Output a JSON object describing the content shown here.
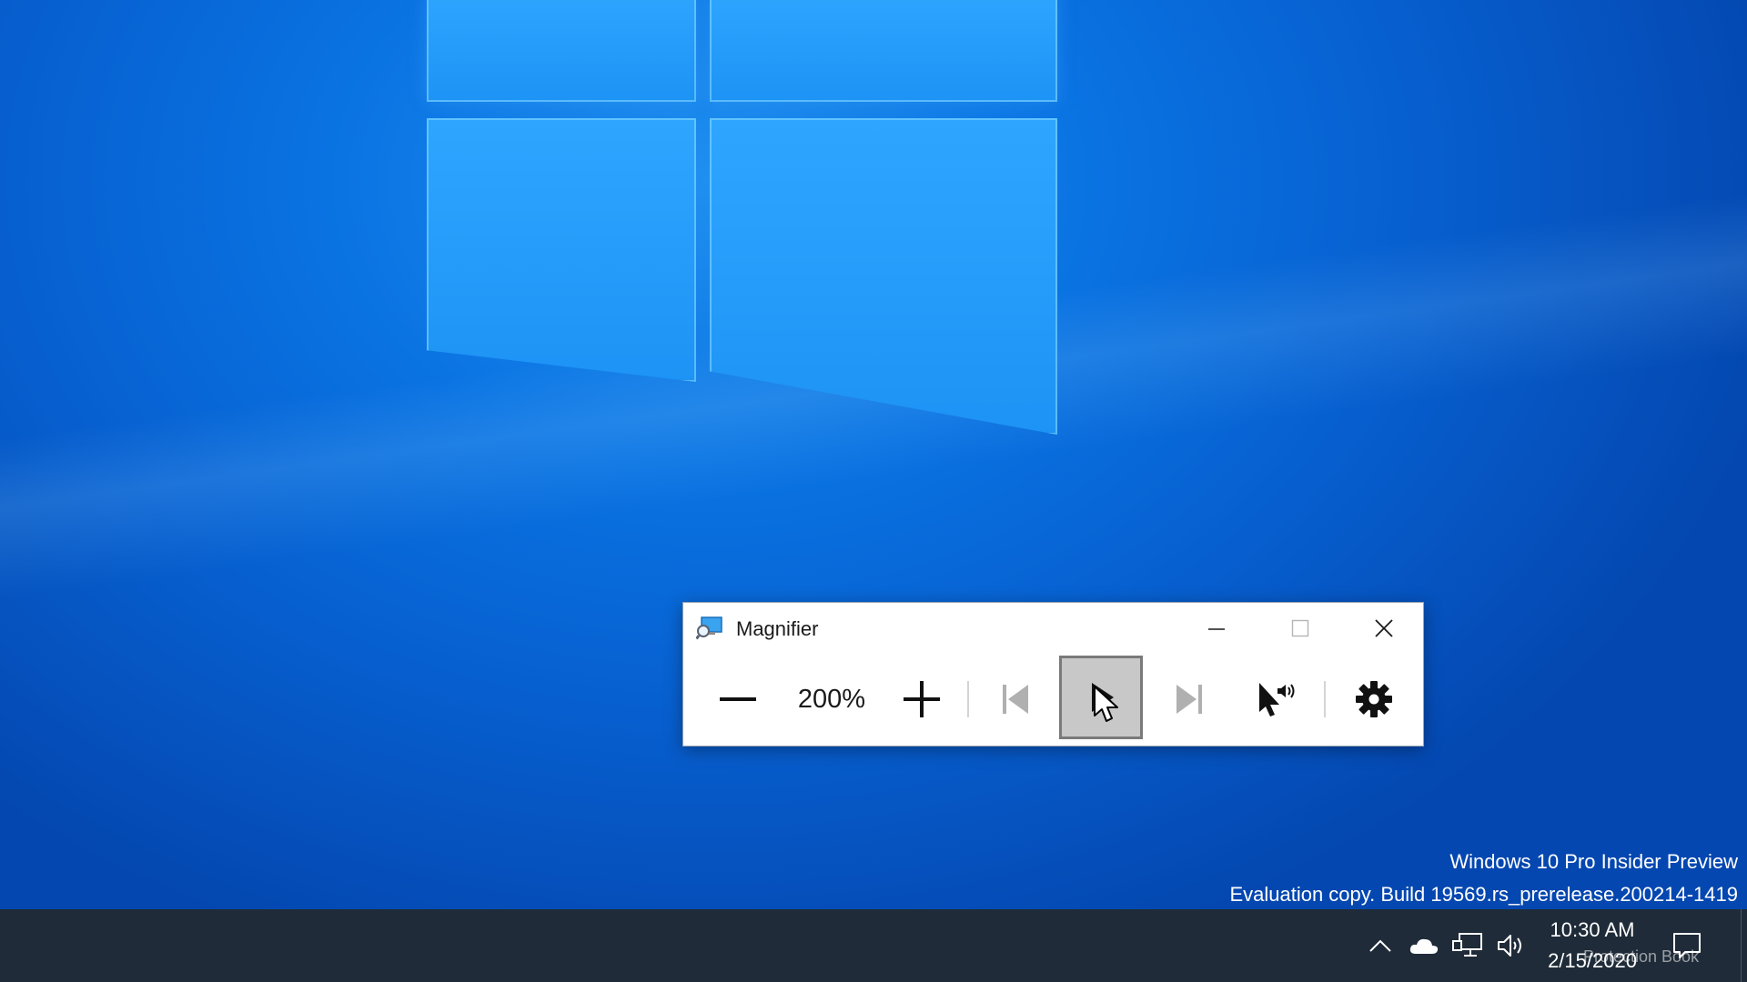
{
  "window": {
    "title": "Magnifier",
    "minimize_icon": "minimize-icon",
    "maximize_icon": "maximize-icon",
    "close_icon": "close-icon"
  },
  "toolbar": {
    "zoom_level": "200%",
    "zoom_out_icon": "minus-icon",
    "zoom_in_icon": "plus-icon",
    "prev_icon": "skip-previous-icon",
    "play_icon": "play-icon",
    "next_icon": "skip-next-icon",
    "read_from_here_icon": "pointer-speaker-icon",
    "settings_icon": "gear-icon"
  },
  "watermark": {
    "line1": "Windows 10 Pro Insider Preview",
    "line2": "Evaluation copy. Build 19569.rs_prerelease.200214-1419"
  },
  "taskbar": {
    "time": "10:30 AM",
    "date": "2/15/2020",
    "overlay_text": "Protection Book",
    "tray_icons": [
      "chevron-up-icon",
      "onedrive-cloud-icon",
      "network-icon",
      "volume-icon",
      "notification-icon"
    ]
  },
  "colors": {
    "desktop_blue": "#0a73e2",
    "taskbar": "#1f2b38",
    "pressed_button": "#c8c8c8"
  }
}
